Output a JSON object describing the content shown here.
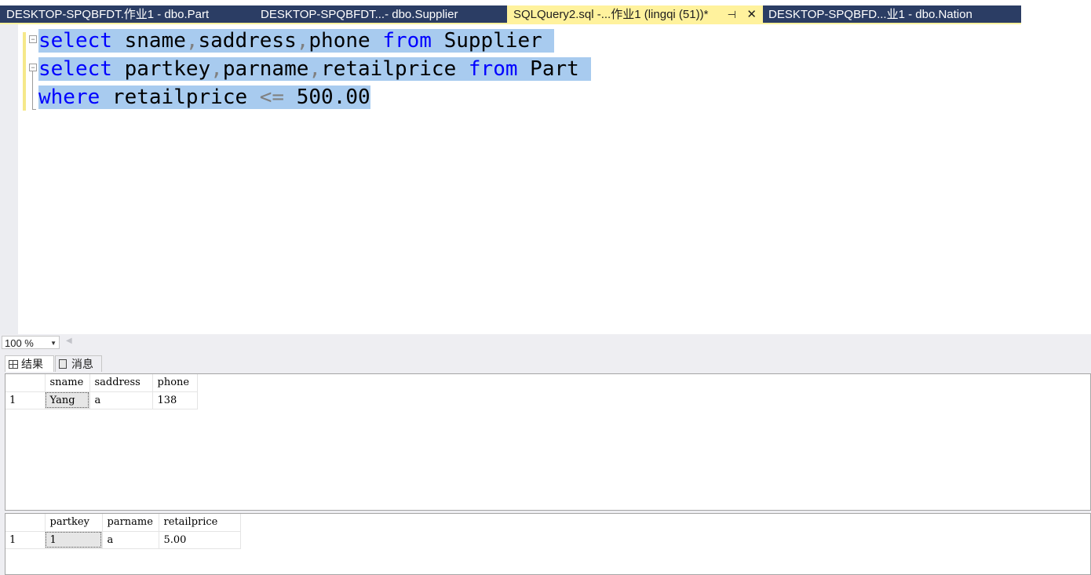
{
  "tabs": [
    {
      "label": "DESKTOP-SPQBFDT.作业1 - dbo.Part",
      "active": false
    },
    {
      "label": "DESKTOP-SPQBFDT...- dbo.Supplier",
      "active": false
    },
    {
      "label": "SQLQuery2.sql -...作业1 (lingqi (51))*",
      "active": true,
      "pin_icon": "pin-icon",
      "close_icon": "close-icon"
    },
    {
      "label": "DESKTOP-SPQBFD...业1 - dbo.Nation",
      "active": false
    }
  ],
  "editor": {
    "line1": {
      "kw1": "select",
      "t1": " sname",
      "c1": ",",
      "t2": "saddress",
      "c2": ",",
      "t3": "phone ",
      "kw2": "from",
      "t4": " Supplier "
    },
    "line2": {
      "kw1": "select",
      "t1": " partkey",
      "c1": ",",
      "t2": "parname",
      "c2": ",",
      "t3": "retailprice ",
      "kw2": "from",
      "t4": " Part "
    },
    "line3": {
      "kw1": "where",
      "t1": " retailprice ",
      "op": "<=",
      "t2": " 500.00"
    },
    "selection_color": "#a8cbef",
    "keyword_color": "#0000ff"
  },
  "zoom": {
    "value": "100 %"
  },
  "result_tabs": [
    {
      "label": "结果",
      "icon": "grid-icon"
    },
    {
      "label": "消息",
      "icon": "messages-icon"
    }
  ],
  "grid1": {
    "columns": [
      "sname",
      "saddress",
      "phone"
    ],
    "rows": [
      {
        "num": "1",
        "cells": [
          "Yang",
          "a",
          "138"
        ]
      }
    ]
  },
  "grid2": {
    "columns": [
      "partkey",
      "parname",
      "retailprice"
    ],
    "rows": [
      {
        "num": "1",
        "cells": [
          "1",
          "a",
          "5.00"
        ]
      }
    ]
  },
  "colors": {
    "tab_band": "#2b3d64",
    "active_tab": "#fff29d"
  }
}
